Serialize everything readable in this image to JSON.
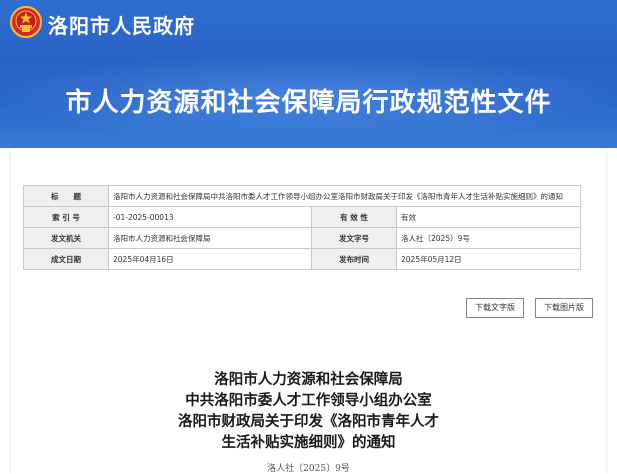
{
  "header": {
    "site_name": "洛阳市人民政府",
    "banner_title": "市人力资源和社会保障局行政规范性文件"
  },
  "meta_table": {
    "title_label": "标　　题",
    "title_value": "洛阳市人力资源和社会保障局中共洛阳市委人才工作领导小组办公室洛阳市财政局关于印发《洛阳市青年人才生活补贴实施细则》的通知",
    "index_label": "索 引 号",
    "index_value": "-01-2025-00013",
    "validity_label": "有 效 性",
    "validity_value": "有效",
    "issuer_label": "发文机关",
    "issuer_value": "洛阳市人力资源和社会保障局",
    "doc_no_label": "发文字号",
    "doc_no_value": "洛人社（2025）9号",
    "created_label": "成文日期",
    "created_value": "2025年04月16日",
    "published_label": "发布时间",
    "published_value": "2025年05月12日"
  },
  "buttons": {
    "download_text": "下载文字版",
    "download_image": "下载图片版"
  },
  "document": {
    "title_lines": [
      "洛阳市人力资源和社会保障局",
      "中共洛阳市委人才工作领导小组办公室",
      "洛阳市财政局关于印发《洛阳市青年人才",
      "生活补贴实施细则》的通知"
    ],
    "doc_number": "洛人社〔2025〕9号"
  },
  "colors": {
    "banner_blue": "#2b68cc",
    "emblem_red": "#d8282a",
    "emblem_gold": "#f2c230"
  }
}
